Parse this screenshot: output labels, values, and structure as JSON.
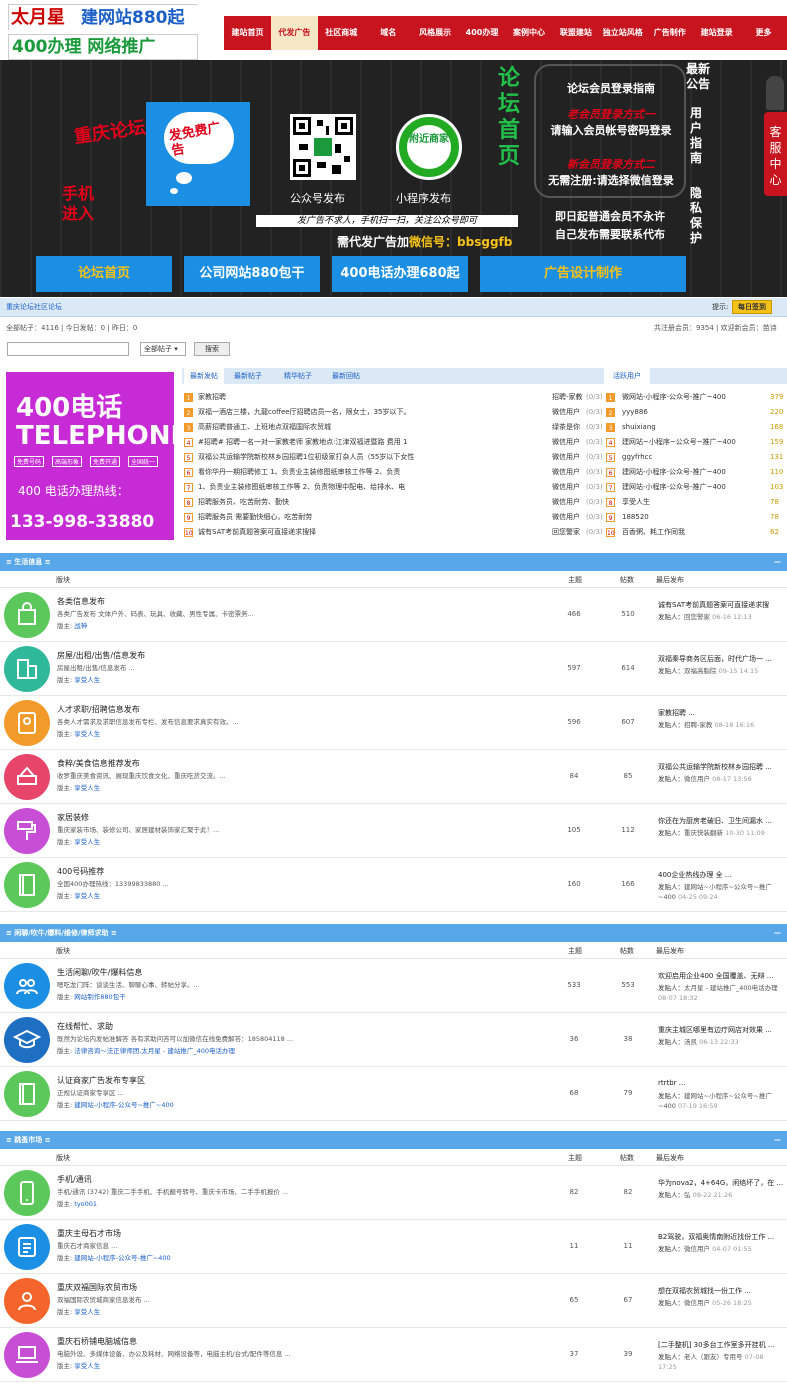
{
  "header": {
    "logo_line1a": "太月星",
    "logo_line1b": "建网站880起",
    "logo_line2": "400办理  网络推广",
    "nav": [
      "建站首页",
      "代发广告",
      "社区商城",
      "域名",
      "风格展示",
      "400办理",
      "案例中心",
      "联盟建站",
      "独立站风格",
      "广告制作",
      "建站登录",
      "更多"
    ],
    "nav_active": 1
  },
  "banner": {
    "chongqing": "重庆论坛",
    "phone": "手机进入",
    "free_ad": "发免费广告",
    "qr1_caption": "公众号发布",
    "qr2_caption": "小程序发布",
    "qr2_text": "附近商家",
    "slogan": "发广告不求人，手机扫一扫，关注公众号即可",
    "need_ad": "需代发广告加",
    "wechat_label": "微信号：",
    "wechat_id": "bbsggfb",
    "forum_home": "论坛首页",
    "login_title": "论坛会员登录指南",
    "old_member": "老会员登录方式一",
    "old_member_desc": "请输入会员帐号密码登录",
    "new_member": "新会员登录方式二",
    "new_member_desc": "无需注册:请选择微信登录",
    "free_notice1": "即日起普通会员不永许",
    "free_notice2": "自己发布需要联系代布",
    "side_news": "最新公告",
    "side_guide": "用户指南",
    "side_privacy": "隐私保护",
    "service": "客服中心",
    "buttons": [
      "论坛首页",
      "公司网站880包干",
      "400电话办理680起",
      "广告设计制作"
    ]
  },
  "forum_bar": {
    "title": "重庆论坛社区论坛",
    "tip": "提示:",
    "sign_btn": "每日签到"
  },
  "stats": {
    "left": "全部帖子：4116 | 今日发帖：0 | 昨日：0",
    "right": "共注册会员：9354 | 欢迎新会员：苗诗"
  },
  "search": {
    "select": "全部帖子",
    "button": "搜索"
  },
  "ad_box": {
    "title1": "400电话",
    "title2": "TELEPHONE",
    "tags": [
      "免费号码",
      "高端形象",
      "免费开通",
      "全国统一"
    ],
    "hotline_label": "400 电话办理热线：",
    "hotline": "133-998-33880"
  },
  "tabs": [
    "最新发帖",
    "最新帖子",
    "精华帖子",
    "最新回帖"
  ],
  "tab_active": "活跃用户",
  "latest": [
    {
      "n": "1",
      "title": "家教招聘",
      "user": "招聘-家教",
      "count": "(0/3)"
    },
    {
      "n": "2",
      "title": "双福一酒店三楼，九龍coffee厅招聘店员一名，限女士，35岁以下。",
      "user": "微信用户",
      "count": "(0/3)"
    },
    {
      "n": "3",
      "title": "高薪招聘普通工、上班地点双福国际农贸城",
      "user": "绿茶是你",
      "count": "(0/3)"
    },
    {
      "n": "4",
      "title": "#招聘# 招聘一名一对一家教老师 家教地点:江津双福进暨路 费用 1",
      "user": "微信用户",
      "count": "(0/3)"
    },
    {
      "n": "5",
      "title": "双福公共运输学院新校林乡园招聘1位初级家打杂人员（55岁以下女性",
      "user": "微信用户",
      "count": "(0/3)"
    },
    {
      "n": "6",
      "title": "看你华丹一期招聘修工 1、负责业主装修图纸审核工作等 2、负责",
      "user": "微信用户",
      "count": "(0/3)"
    },
    {
      "n": "7",
      "title": "1、负责业主装修图纸审核工作等 2、负责物理中配电、给排水、电",
      "user": "微信用户",
      "count": "(0/3)"
    },
    {
      "n": "8",
      "title": "招聘服务员、吃苦耐劳、勤快",
      "user": "微信用户",
      "count": "(0/3)"
    },
    {
      "n": "9",
      "title": "招聘服务员 需要勤快细心，吃苦耐劳",
      "user": "微信用户",
      "count": "(0/3)"
    },
    {
      "n": "10",
      "title": "诚有SAT考前真题答案可直接递求搜择",
      "user": "回您警家",
      "count": "(0/3)"
    }
  ],
  "active_users": [
    {
      "n": "1",
      "name": "微网站-小程序-公众号-推广~400",
      "c": "379"
    },
    {
      "n": "2",
      "name": "yyy886",
      "c": "220"
    },
    {
      "n": "3",
      "name": "shuixiang",
      "c": "168"
    },
    {
      "n": "4",
      "name": "建网站~小程序~公众号~推广~400",
      "c": "159"
    },
    {
      "n": "5",
      "name": "ggyfrhcc",
      "c": "131"
    },
    {
      "n": "6",
      "name": "建网站-小程序-公众号-推广~400",
      "c": "110"
    },
    {
      "n": "7",
      "name": "建网站-小程序-公众号-推广~400",
      "c": "103"
    },
    {
      "n": "8",
      "name": "享受人生",
      "c": "78"
    },
    {
      "n": "9",
      "name": "188520",
      "c": "78"
    },
    {
      "n": "10",
      "name": "百香粥、耗工作同我",
      "c": "62"
    }
  ],
  "sections": [
    {
      "title": "≡ 生活信息 ≡",
      "col_block": "版块",
      "col_topics": "主题",
      "col_posts": "帖数",
      "col_last": "最后发布",
      "rows": [
        {
          "icon": "shopping-bag-icon",
          "color": "#5cc85b",
          "title": "各类信息发布",
          "desc": "各类广告发布 文体户外、码表、玩具、收藏、男性专属、卡密票务...",
          "owner_label": "版主:",
          "owner": "战神",
          "topics": "466",
          "posts": "510",
          "last_title": "诚有SAT考前真题答案可直接递求搜",
          "last_by": "发贴人：",
          "last_user": "回您警家",
          "last_time": "06-16 12:13"
        },
        {
          "icon": "buildings-icon",
          "color": "#2fb89a",
          "title": "房屋/出租/出售/信息发布",
          "desc": "房屋出租/出售/信息发布 ...",
          "owner_label": "版主:",
          "owner": "享受人生",
          "topics": "597",
          "posts": "614",
          "last_title": "双福秦导商务区后面，时代广场一 ...",
          "last_by": "发贴人：",
          "last_user": "双福高脂院",
          "last_time": "09-15 14:15"
        },
        {
          "icon": "id-card-icon",
          "color": "#f39b2a",
          "title": "人才求职/招聘信息发布",
          "desc": "各类人才需求及求职信息发布专栏、发布信息要求真实有效。...",
          "owner_label": "版主:",
          "owner": "享受人生",
          "topics": "596",
          "posts": "607",
          "last_title": "家教招聘 ...",
          "last_by": "发贴人：",
          "last_user": "招聘-家教",
          "last_time": "08-18 16:16"
        },
        {
          "icon": "cake-icon",
          "color": "#e8456a",
          "title": "食粹/美食信息推荐发布",
          "desc": "收罗重庆美食资讯、展现重庆饮食文化、重庆吃货交流。...",
          "owner_label": "版主:",
          "owner": "享受人生",
          "topics": "84",
          "posts": "85",
          "last_title": "双福公共运输学院新校林乡园招聘 ...",
          "last_by": "发贴人：",
          "last_user": "微信用户",
          "last_time": "08-17 13:56"
        },
        {
          "icon": "paint-roller-icon",
          "color": "#c74fd6",
          "title": "家居装修",
          "desc": "重庆家装市场、装修公司、家居建材装饰家汇聚于此！...",
          "owner_label": "版主:",
          "owner": "享受人生",
          "topics": "105",
          "posts": "112",
          "last_title": "你还在为厨房老破旧、卫生间漏水 ...",
          "last_by": "发贴人：",
          "last_user": "重庆快装翻新",
          "last_time": "10-30 11:09"
        },
        {
          "icon": "book-icon",
          "color": "#5cc85b",
          "title": "400号码推荐",
          "desc": "全国400办理热线：13399833880 ...",
          "owner_label": "版主:",
          "owner": "享受人生",
          "topics": "160",
          "posts": "166",
          "last_title": "400企业热线办理 全 ...",
          "last_by": "发贴人：",
          "last_user": "建网站~小程序~公众号~推广~400",
          "last_time": "04-25 09:24"
        }
      ]
    },
    {
      "title": "≡ 闲聊/吹牛/爆料/维修/律师求助 ≡",
      "col_block": "版块",
      "col_topics": "主题",
      "col_posts": "帖数",
      "col_last": "最后发布",
      "rows": [
        {
          "icon": "users-icon",
          "color": "#1b8fe3",
          "title": "生活闲聊/吹牛/爆料信息",
          "desc": "嗯吃龙门阵：谈谈生活、聊聊心事、转帖分享。...",
          "owner_label": "版主:",
          "owner": "网站制作880包干",
          "topics": "533",
          "posts": "553",
          "last_title": "欢迎启用企业400 全国覆盖、无辩 ...",
          "last_by": "发贴人：",
          "last_user": "太月星 - 建站推广_400电话办理",
          "last_time": "08-07 18:32"
        },
        {
          "icon": "graduation-cap-icon",
          "color": "#1e6ec2",
          "title": "在线帮忙、求助",
          "desc": "既然为论坛内发帖准解答 各有求助问答可以加微信在线免费解答：185804118 ...",
          "owner_label": "版主:",
          "owner": "法律咨询～法正律师团,太月星 - 建站推广_400电话办理",
          "topics": "36",
          "posts": "38",
          "last_title": "重庆主城区哪里有边疗网店对效果 ...",
          "last_by": "发贴人：",
          "last_user": "汤凯",
          "last_time": "06-13 22:33"
        },
        {
          "icon": "book-icon",
          "color": "#5cc85b",
          "title": "认证商家广告发布专享区",
          "desc": "正规认证商家专享区 ...",
          "owner_label": "版主:",
          "owner": "建网站-小程序-公众号~推广~400",
          "topics": "68",
          "posts": "79",
          "last_title": "rtrtbr ...",
          "last_by": "发贴人：",
          "last_user": "建网站~小程序~公众号~推广~400",
          "last_time": "07-19 16:59"
        }
      ]
    },
    {
      "title": "≡ 跳蚤市场 ≡",
      "col_block": "版块",
      "col_topics": "主题",
      "col_posts": "帖数",
      "col_last": "最后发布",
      "rows": [
        {
          "icon": "mobile-phone-icon",
          "color": "#5cc85b",
          "title": "手机/通讯",
          "desc": "手机/通讯 (3742) 重庆二手手机、手机靓号转号、重庆卡市场、二手手机报价 ...",
          "owner_label": "版主:",
          "owner": "tyo001",
          "topics": "82",
          "posts": "82",
          "last_title": "华为nova2，4+64G，闲络坏了，在 ...",
          "last_by": "发贴人：",
          "last_user": "弘",
          "last_time": "09-22 21:26"
        },
        {
          "icon": "id-badge-icon",
          "color": "#1b8fe3",
          "title": "重庆主母石才市场",
          "desc": "重庆石才商家信息 ...",
          "owner_label": "版主:",
          "owner": "建网站-小程序-公众号-推广~400",
          "topics": "11",
          "posts": "11",
          "last_title": "B2驾驶，双福奥情南附近找份工作 ...",
          "last_by": "发贴人：",
          "last_user": "微信用户",
          "last_time": "04-07 01:55"
        },
        {
          "icon": "people-icon",
          "color": "#f3652a",
          "title": "重庆双福国际农贸市场",
          "desc": "双福国际农贸城商家信息发布 ...",
          "owner_label": "版主:",
          "owner": "享受人生",
          "topics": "65",
          "posts": "67",
          "last_title": "想在双福农贸城找一份工作 ...",
          "last_by": "发贴人：",
          "last_user": "微信用户",
          "last_time": "05-26 18:25"
        },
        {
          "icon": "laptop-icon",
          "color": "#c74fd6",
          "title": "重庆石桥铺电脑城信息",
          "desc": "电脑外设、多媒体设备、办公及耗材、网络设备等，电脑主机/台式/配件等信息 ...",
          "owner_label": "版主:",
          "owner": "享受人生",
          "topics": "37",
          "posts": "39",
          "last_title": "[二手整机] 30多台工作室多开挂机 ...",
          "last_by": "发贴人：",
          "last_user": "老人（跟友）专用号",
          "last_time": "07-08 17:25"
        }
      ]
    }
  ]
}
